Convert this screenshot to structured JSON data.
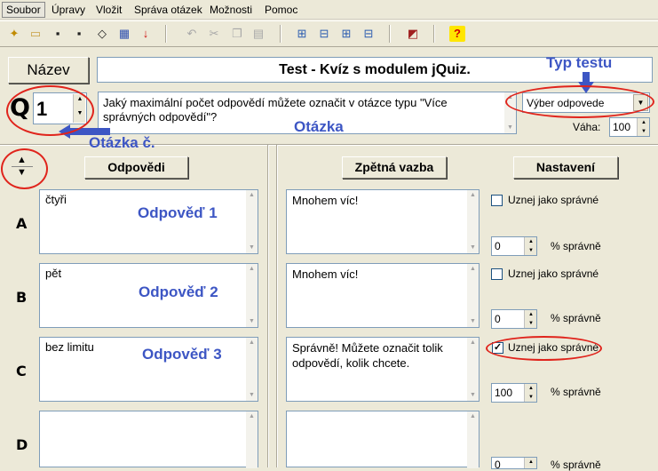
{
  "menu": [
    "Soubor",
    "Úpravy",
    "Vložit",
    "Správa otázek",
    "Možnosti",
    "Pomoc"
  ],
  "title_button": "Název",
  "quiz_title": "Test - Kvíz s modulem jQuiz.",
  "question_prefix": "Q",
  "question_number": "1",
  "question_text": "Jaký maximální počet odpovědí můžete označit v otázce typu \"Více správných odpovědí\"?",
  "question_type": "Výber odpovede",
  "weight_label": "Váha:",
  "weight_value": "100",
  "headers": {
    "answers": "Odpovědi",
    "feedback": "Zpětná vazba",
    "settings": "Nastavení"
  },
  "answers": [
    {
      "letter": "A",
      "text": "čtyři",
      "feedback": "Mnohem víc!",
      "accept_label": "Uznej jako správné",
      "checked": false,
      "percent": "0",
      "percent_label": "% správně"
    },
    {
      "letter": "B",
      "text": "pět",
      "feedback": "Mnohem víc!",
      "accept_label": "Uznej jako správné",
      "checked": false,
      "percent": "0",
      "percent_label": "% správně"
    },
    {
      "letter": "C",
      "text": "bez limitu",
      "feedback": "Správně! Můžete označit tolik odpovědí, kolik chcete.",
      "accept_label": "Uznej jako správné",
      "checked": true,
      "percent": "100",
      "percent_label": "% správně"
    },
    {
      "letter": "D",
      "text": "",
      "feedback": "",
      "accept_label": "",
      "checked": false,
      "percent": "0",
      "percent_label": "% správně"
    }
  ],
  "annotations": {
    "test_type": "Typ testu",
    "question": "Otázka",
    "question_no": "Otázka č.",
    "answer1": "Odpověď 1",
    "answer2": "Odpověď 2",
    "answer3": "Odpověď 3"
  },
  "colors": {
    "annotation_blue": "#3d56c4",
    "annotation_red": "#e0241c",
    "window_bg": "#ece9d8"
  }
}
